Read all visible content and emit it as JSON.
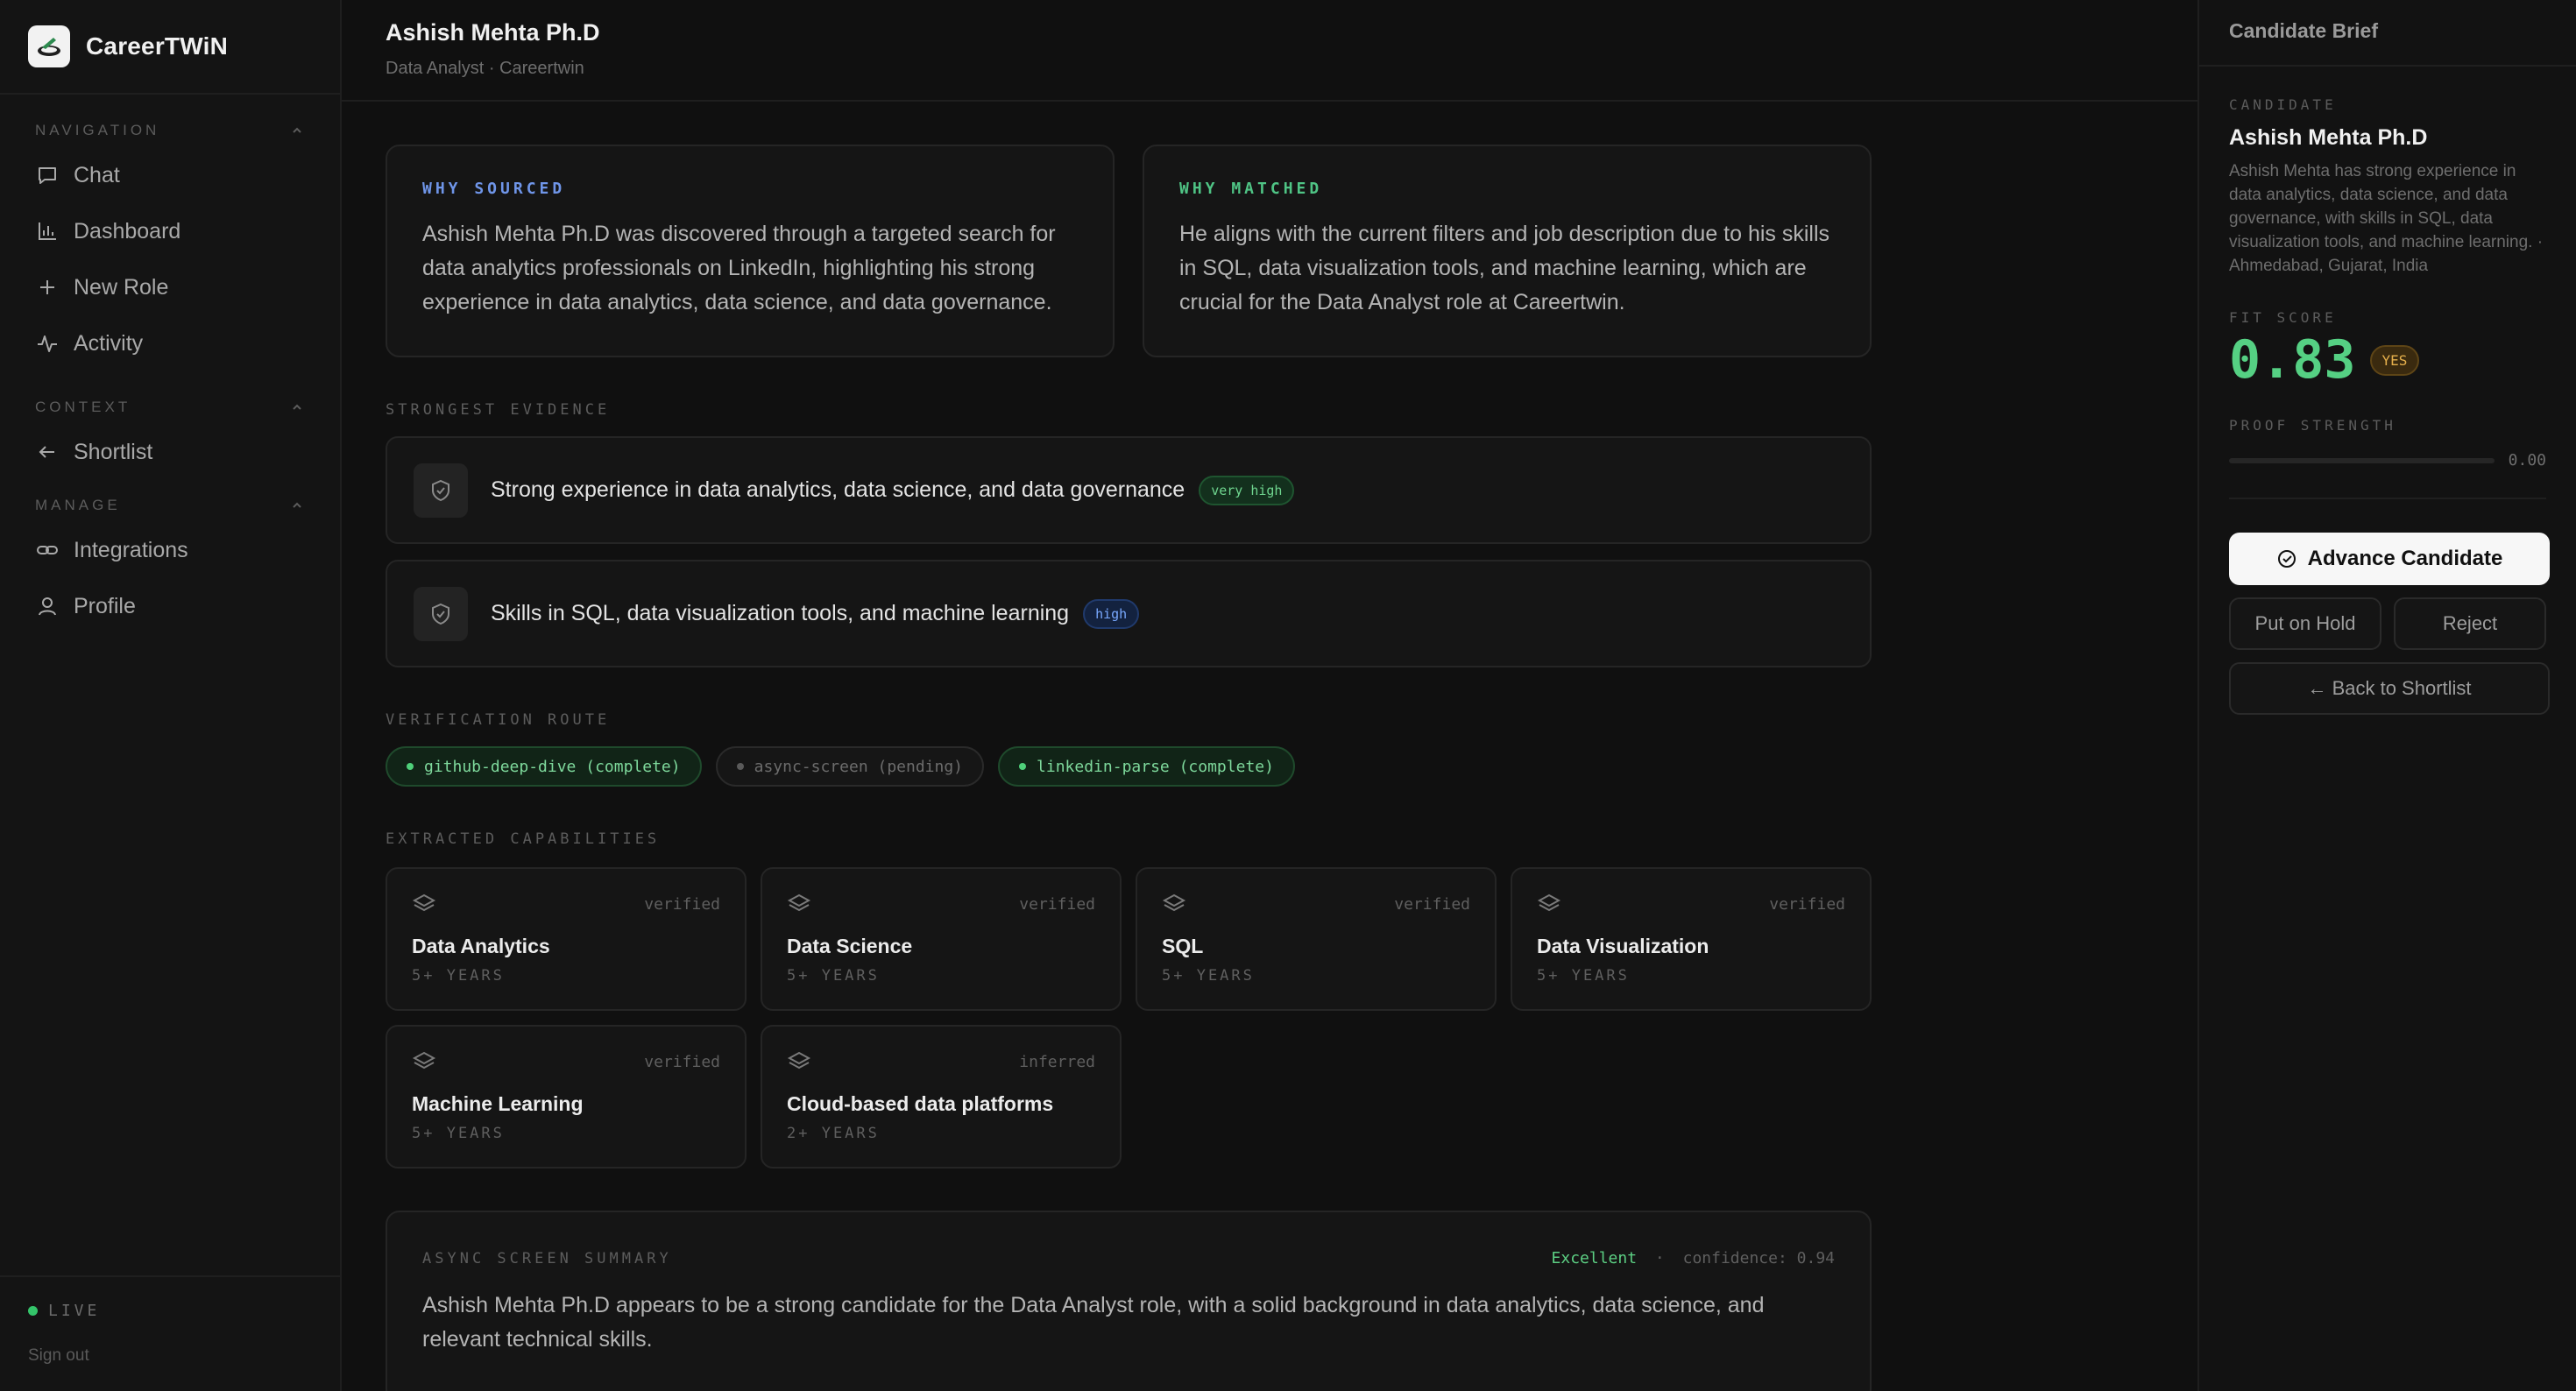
{
  "brand": {
    "name": "CareerTWiN"
  },
  "sidebar": {
    "sections": [
      {
        "title": "NAVIGATION",
        "items": [
          {
            "label": "Chat",
            "icon": "chat-icon"
          },
          {
            "label": "Dashboard",
            "icon": "bar-chart-icon"
          },
          {
            "label": "New Role",
            "icon": "plus-icon"
          },
          {
            "label": "Activity",
            "icon": "activity-icon"
          }
        ]
      },
      {
        "title": "CONTEXT",
        "items": [
          {
            "label": "Shortlist",
            "icon": "arrow-left-icon"
          }
        ]
      },
      {
        "title": "MANAGE",
        "items": [
          {
            "label": "Integrations",
            "icon": "link-icon"
          },
          {
            "label": "Profile",
            "icon": "user-icon"
          }
        ]
      }
    ],
    "status": "LIVE",
    "signout": "Sign out"
  },
  "header": {
    "title": "Ashish Mehta Ph.D",
    "subtitle": "Data Analyst · Careertwin"
  },
  "why": {
    "sourced": {
      "label": "WHY SOURCED",
      "text": "Ashish Mehta Ph.D was discovered through a targeted search for data analytics professionals on LinkedIn, highlighting his strong experience in data analytics, data science, and data governance."
    },
    "matched": {
      "label": "WHY MATCHED",
      "text": "He aligns with the current filters and job description due to his skills in SQL, data visualization tools, and machine learning, which are crucial for the Data Analyst role at Careertwin."
    }
  },
  "evidence": {
    "title": "STRONGEST EVIDENCE",
    "items": [
      {
        "text": "Strong experience in data analytics, data science, and data governance",
        "badge": "very high"
      },
      {
        "text": "Skills in SQL, data visualization tools, and machine learning",
        "badge": "high"
      }
    ]
  },
  "route": {
    "title": "VERIFICATION ROUTE",
    "steps": [
      {
        "label": "github-deep-dive (complete)",
        "state": "complete"
      },
      {
        "label": "async-screen (pending)",
        "state": "pending"
      },
      {
        "label": "linkedin-parse (complete)",
        "state": "complete"
      }
    ]
  },
  "capabilities": {
    "title": "EXTRACTED CAPABILITIES",
    "items": [
      {
        "name": "Data Analytics",
        "years": "5+ YEARS",
        "status": "verified"
      },
      {
        "name": "Data Science",
        "years": "5+ YEARS",
        "status": "verified"
      },
      {
        "name": "SQL",
        "years": "5+ YEARS",
        "status": "verified"
      },
      {
        "name": "Data Visualization",
        "years": "5+ YEARS",
        "status": "verified"
      },
      {
        "name": "Machine Learning",
        "years": "5+ YEARS",
        "status": "verified"
      },
      {
        "name": "Cloud-based data platforms",
        "years": "2+ YEARS",
        "status": "inferred"
      }
    ]
  },
  "summary": {
    "title": "ASYNC SCREEN SUMMARY",
    "rating": "Excellent",
    "separator": "·",
    "confidence": "confidence: 0.94",
    "text": "Ashish Mehta Ph.D appears to be a strong candidate for the Data Analyst role, with a solid background in data analytics, data science, and relevant technical skills."
  },
  "brief": {
    "title": "Candidate Brief",
    "candidate_label": "CANDIDATE",
    "name": "Ashish Mehta Ph.D",
    "description": "Ashish Mehta has strong experience in data analytics, data science, and data governance, with skills in SQL, data visualization tools, and machine learning. · Ahmedabad, Gujarat, India",
    "fit_label": "FIT SCORE",
    "fit_score": "0.83",
    "fit_badge": "YES",
    "proof_label": "PROOF STRENGTH",
    "proof_value": "0.00",
    "proof_fraction": 0.0,
    "advance": "Advance Candidate",
    "hold": "Put on Hold",
    "reject": "Reject",
    "back": "← Back to Shortlist"
  },
  "colors": {
    "accent_green": "#55d083",
    "sourced_label": "#6f95e8",
    "matched_label": "#4fc485",
    "badge_yes": "#e6b04c"
  }
}
